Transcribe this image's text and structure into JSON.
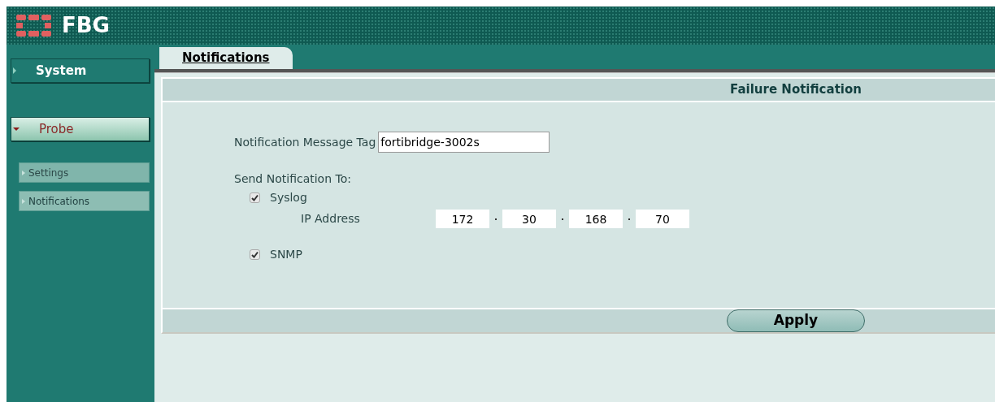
{
  "header": {
    "logo_text": "FBG"
  },
  "sidebar": {
    "items": [
      {
        "label": "System",
        "expanded": false,
        "selected": false
      },
      {
        "label": "Probe",
        "expanded": true,
        "selected": true,
        "children": [
          {
            "label": "Settings",
            "selected": false
          },
          {
            "label": "Notifications",
            "selected": true
          }
        ]
      }
    ]
  },
  "tabs": [
    {
      "label": "Notifications",
      "selected": true
    }
  ],
  "panel": {
    "title": "Failure Notification",
    "tag_label": "Notification Message Tag",
    "tag_value": "fortibridge-3002s",
    "send_label": "Send Notification To:",
    "targets": [
      {
        "label": "Syslog",
        "checked": true,
        "ip_label": "IP Address",
        "ip": [
          "172",
          "30",
          "168",
          "70"
        ]
      },
      {
        "label": "SNMP",
        "checked": true
      }
    ],
    "apply": "Apply"
  }
}
